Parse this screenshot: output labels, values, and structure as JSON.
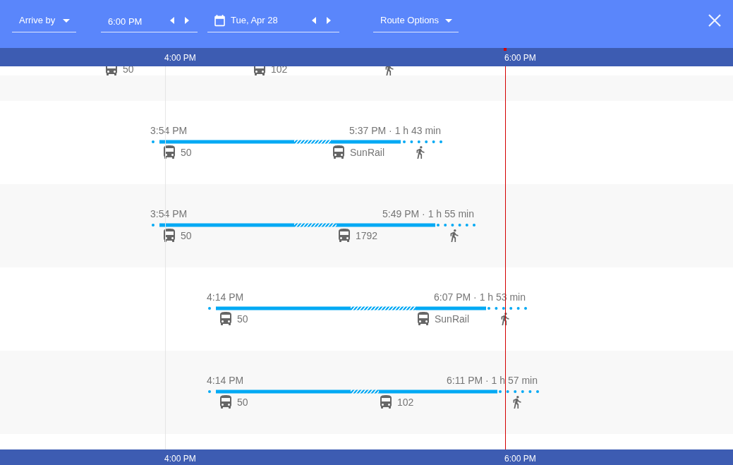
{
  "header": {
    "mode": {
      "label": "Arrive by"
    },
    "time": {
      "value": "6:00 PM"
    },
    "date": {
      "value": "Tue, Apr 28"
    },
    "route_options": {
      "label": "Route Options"
    }
  },
  "axis_top": {
    "ticks": [
      "4:00 PM",
      "6:00 PM"
    ]
  },
  "routes": [
    {
      "legs": [
        {
          "kind": "bus",
          "label": "50"
        },
        {
          "kind": "bus",
          "label": "102"
        },
        {
          "kind": "walk"
        }
      ]
    },
    {
      "depart": "3:54 PM",
      "arrival": "5:37 PM · 1 h 43 min",
      "legs": [
        {
          "kind": "bus",
          "label": "50"
        },
        {
          "kind": "bus",
          "label": "SunRail"
        },
        {
          "kind": "walk"
        }
      ]
    },
    {
      "depart": "3:54 PM",
      "arrival": "5:49 PM · 1 h 55 min",
      "legs": [
        {
          "kind": "bus",
          "label": "50"
        },
        {
          "kind": "bus",
          "label": "1792"
        },
        {
          "kind": "walk"
        }
      ]
    },
    {
      "depart": "4:14 PM",
      "arrival": "6:07 PM · 1 h 53 min",
      "legs": [
        {
          "kind": "bus",
          "label": "50"
        },
        {
          "kind": "bus",
          "label": "SunRail"
        },
        {
          "kind": "walk"
        }
      ]
    },
    {
      "depart": "4:14 PM",
      "arrival": "6:11 PM · 1 h 57 min",
      "legs": [
        {
          "kind": "bus",
          "label": "50"
        },
        {
          "kind": "bus",
          "label": "102"
        },
        {
          "kind": "walk"
        }
      ]
    }
  ],
  "axis_bottom": {
    "ticks": [
      "4:00 PM",
      "6:00 PM"
    ]
  }
}
